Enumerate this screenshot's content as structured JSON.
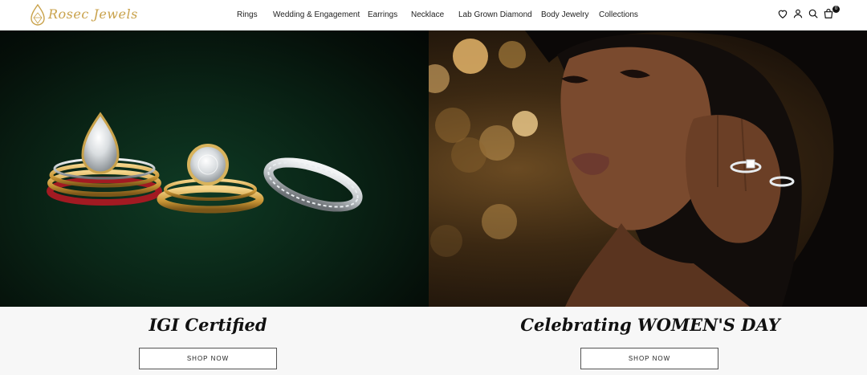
{
  "brand": {
    "name": "Rosec Jewels"
  },
  "nav": {
    "items": [
      {
        "label": "Rings"
      },
      {
        "label": "Wedding & Engagement"
      },
      {
        "label": "Earrings"
      },
      {
        "label": "Necklace"
      },
      {
        "label": "Lab Grown Diamond"
      },
      {
        "label": "Body Jewelry"
      },
      {
        "label": "Collections"
      }
    ]
  },
  "header_icons": {
    "items": [
      "heart-icon",
      "user-icon",
      "search-icon",
      "shopping-bag-icon"
    ],
    "cart_count": "0"
  },
  "hero": {
    "left": {
      "title": "IGI Certified",
      "button_label": "SHOP NOW"
    },
    "right": {
      "title": "Celebrating WOMEN'S DAY",
      "button_label": "SHOP NOW"
    }
  },
  "colors": {
    "brand_gold": "#c9a24b",
    "text": "#222222",
    "caption_band": "#f7f7f7"
  }
}
